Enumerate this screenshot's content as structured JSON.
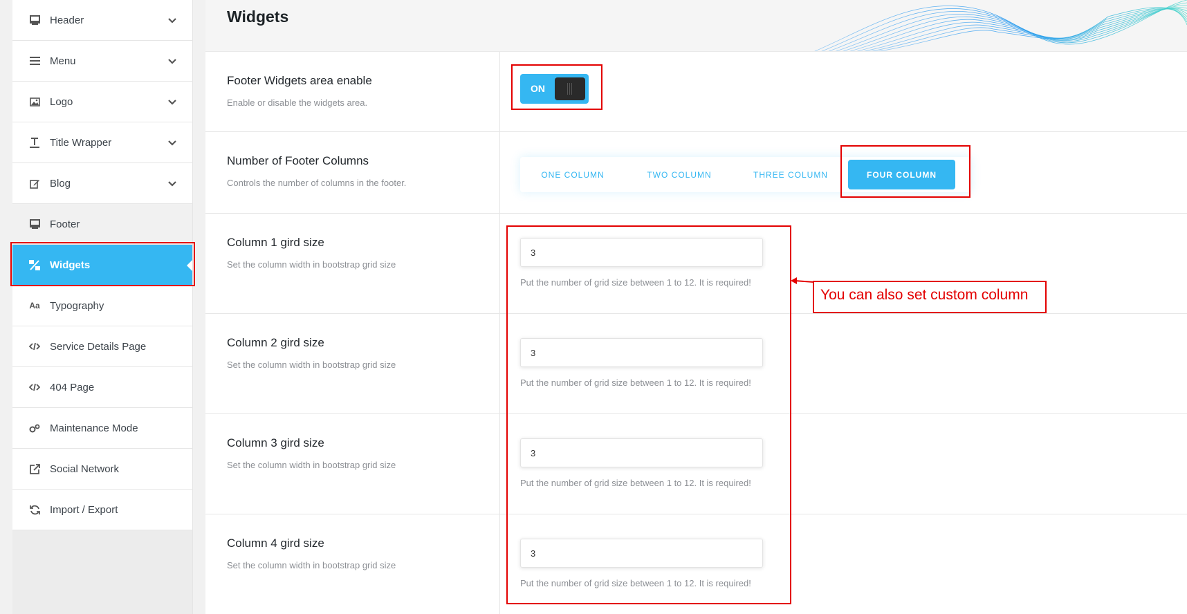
{
  "sidebar": {
    "items": [
      {
        "label": "Header",
        "icon": "monitor-icon",
        "has_chevron": true
      },
      {
        "label": "Menu",
        "icon": "menu-lines-icon",
        "has_chevron": true
      },
      {
        "label": "Logo",
        "icon": "image-icon",
        "has_chevron": true
      },
      {
        "label": "Title Wrapper",
        "icon": "text-cursor-icon",
        "has_chevron": true
      },
      {
        "label": "Blog",
        "icon": "edit-icon",
        "has_chevron": true
      },
      {
        "label": "Footer",
        "icon": "monitor-icon",
        "has_chevron": false
      },
      {
        "label": "Widgets",
        "icon": "percent-icon",
        "active": true
      },
      {
        "label": "Typography",
        "icon": "typography-icon"
      },
      {
        "label": "Service Details Page",
        "icon": "code-icon"
      },
      {
        "label": "404 Page",
        "icon": "code-icon"
      },
      {
        "label": "Maintenance Mode",
        "icon": "gears-icon"
      },
      {
        "label": "Social Network",
        "icon": "share-icon"
      },
      {
        "label": "Import / Export",
        "icon": "refresh-icon"
      }
    ]
  },
  "page": {
    "title": "Widgets"
  },
  "options": {
    "footer_widgets": {
      "title": "Footer Widgets area enable",
      "desc": "Enable or disable the widgets area.",
      "toggle_label": "ON"
    },
    "footer_columns": {
      "title": "Number of Footer Columns",
      "desc": "Controls the number of columns in the footer.",
      "buttons": [
        "ONE COLUMN",
        "TWO COLUMN",
        "THREE COLUMN",
        "FOUR COLUMN"
      ],
      "selected": "FOUR COLUMN"
    },
    "columns": [
      {
        "title": "Column 1 gird size",
        "desc": "Set the column width in bootstrap grid size",
        "value": "3",
        "hint": "Put the number of grid size between 1 to 12. It is required!"
      },
      {
        "title": "Column 2 gird size",
        "desc": "Set the column width in bootstrap grid size",
        "value": "3",
        "hint": "Put the number of grid size between 1 to 12. It is required!"
      },
      {
        "title": "Column 3 gird size",
        "desc": "Set the column width in bootstrap grid size",
        "value": "3",
        "hint": "Put the number of grid size between 1 to 12. It is required!"
      },
      {
        "title": "Column 4 gird size",
        "desc": "Set the column width in bootstrap grid size",
        "value": "3",
        "hint": "Put the number of grid size between 1 to 12. It is required!"
      }
    ]
  },
  "annotation": {
    "note": "You can also set custom column"
  },
  "colors": {
    "accent": "#35b7f2",
    "annotation_red": "#e30000"
  }
}
